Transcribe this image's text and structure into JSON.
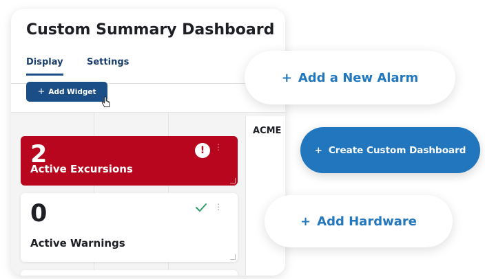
{
  "dashboard": {
    "title": "Custom Summary Dashboard",
    "tabs": [
      {
        "label": "Display",
        "active": true
      },
      {
        "label": "Settings",
        "active": false
      }
    ],
    "add_widget_label": "Add Widget",
    "add_widget_icon": "+",
    "widgets": [
      {
        "count": "2",
        "label": "Active Excursions",
        "status_icon": "exclamation-alert-icon",
        "color": "#b8061e"
      },
      {
        "count": "0",
        "label": "Active Warnings",
        "status_icon": "checkmark-icon",
        "color": "#2e9e6a"
      }
    ],
    "side_panel_label": "ACME"
  },
  "actions": {
    "add_alarm": {
      "icon": "+",
      "label": "Add a New Alarm"
    },
    "create_dashboard": {
      "icon": "+",
      "label": "Create Custom Dashboard"
    },
    "add_hardware": {
      "icon": "+",
      "label": "Add Hardware"
    }
  },
  "colors": {
    "brand_navy": "#1b4e86",
    "accent_blue": "#2176bd",
    "alert_red": "#b8061e"
  }
}
